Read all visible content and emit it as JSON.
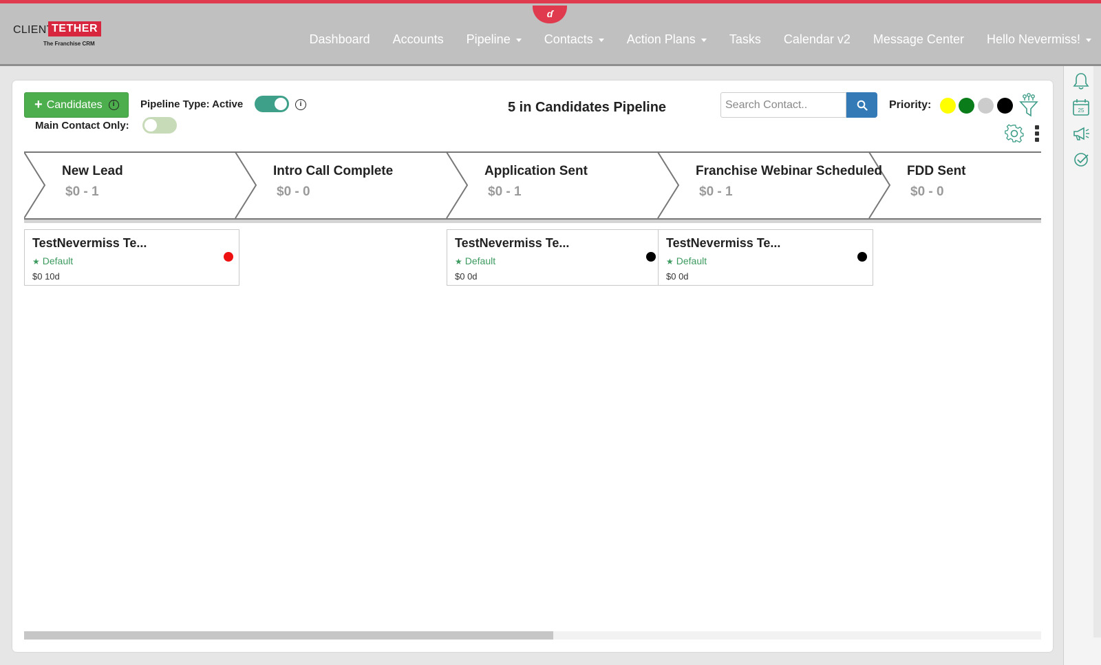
{
  "header": {
    "logo": {
      "client": "CLIENT",
      "tether": "TETHER",
      "tagline": "The Franchise CRM"
    },
    "nav": [
      {
        "label": "Dashboard",
        "dropdown": false
      },
      {
        "label": "Accounts",
        "dropdown": false
      },
      {
        "label": "Pipeline",
        "dropdown": true
      },
      {
        "label": "Contacts",
        "dropdown": true
      },
      {
        "label": "Action Plans",
        "dropdown": true
      },
      {
        "label": "Tasks",
        "dropdown": false
      },
      {
        "label": "Calendar v2",
        "dropdown": false
      },
      {
        "label": "Message Center",
        "dropdown": false
      },
      {
        "label": "Hello Nevermiss!",
        "dropdown": true
      }
    ],
    "accent_color": "#e03a4e"
  },
  "toolbar": {
    "add_button_label": "Candidates",
    "pipeline_type_label": "Pipeline Type: Active",
    "pipeline_type_active": true,
    "main_contact_label": "Main Contact Only:",
    "main_contact_only": false,
    "count_title": "5 in Candidates Pipeline",
    "search_placeholder": "Search Contact..",
    "priority_label": "Priority:",
    "priority_colors": [
      "#ffff00",
      "#0a7d1a",
      "#cccccc",
      "#000000"
    ]
  },
  "stages": [
    {
      "name": "New Lead",
      "summary": "$0 - 1"
    },
    {
      "name": "Intro Call Complete",
      "summary": "$0 - 0"
    },
    {
      "name": "Application Sent",
      "summary": "$0 - 1"
    },
    {
      "name": "Franchise Webinar Scheduled",
      "summary": "$0 - 1"
    },
    {
      "name": "FDD Sent",
      "summary": "$0 - 0"
    }
  ],
  "cards": [
    {
      "stage": 0,
      "name": "TestNevermiss Te...",
      "tag": "Default",
      "meta": "$0  10d",
      "priority_color": "#ee1111"
    },
    {
      "stage": 2,
      "name": "TestNevermiss Te...",
      "tag": "Default",
      "meta": "$0  0d",
      "priority_color": "#000000"
    },
    {
      "stage": 3,
      "name": "TestNevermiss Te...",
      "tag": "Default",
      "meta": "$0  0d",
      "priority_color": "#000000"
    }
  ],
  "right_rail": [
    {
      "icon": "bell-icon"
    },
    {
      "icon": "calendar-icon",
      "text": "25"
    },
    {
      "icon": "megaphone-icon"
    },
    {
      "icon": "check-circle-icon"
    }
  ],
  "scroll_position": 0.52
}
